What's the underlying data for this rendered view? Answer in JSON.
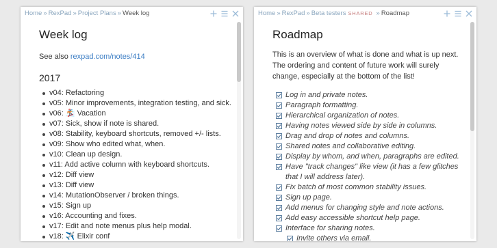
{
  "colors": {
    "breadcrumb": "#8aa6be",
    "accent_link": "#3b7dc4",
    "shared_badge": "#c47979",
    "checkbox": "#4a6f94"
  },
  "left_panel": {
    "breadcrumb": [
      "Home",
      "RexPad",
      "Project Plans",
      "Week log"
    ],
    "breadcrumb_separator": "»",
    "actions": [
      "plus-icon",
      "menu-icon",
      "close-icon"
    ],
    "title": "Week log",
    "see_also_prefix": "See also ",
    "see_also_link": "rexpad.com/notes/414",
    "year": "2017",
    "entries": [
      "v04: Refactoring",
      "v05: Minor improvements, integration testing, and sick.",
      "v06: 🏂 Vacation",
      "v07: Sick, show if note is shared.",
      "v08: Stability, keyboard shortcuts, removed +/- lists.",
      "v09: Show who edited what, when.",
      "v10: Clean up design.",
      "v11: Add active column with keyboard shortcuts.",
      "v12: Diff view",
      "v13: Diff view",
      "v14: MutationObserver / broken things.",
      "v15: Sign up",
      "v16: Accounting and fixes.",
      "v17: Edit and note menus plus help modal.",
      "v18: ✈️ Elixir conf"
    ]
  },
  "right_panel": {
    "breadcrumb": [
      "Home",
      "RexPad",
      "Beta testers"
    ],
    "shared_label": "Shared",
    "current": "Roadmap",
    "breadcrumb_separator": "»",
    "actions": [
      "plus-icon",
      "menu-icon",
      "close-icon"
    ],
    "title": "Roadmap",
    "intro": "This is an overview of what is done and what is up next. The ordering and content of future work will surely change, especially at the bottom of the list!",
    "tasks": [
      {
        "text": "Log in and private notes.",
        "done": true
      },
      {
        "text": "Paragraph formatting.",
        "done": true
      },
      {
        "text": "Hierarchical organization of notes.",
        "done": true
      },
      {
        "text": "Having notes viewed side by side in columns.",
        "done": true
      },
      {
        "text": "Drag and drop of notes and columns.",
        "done": true
      },
      {
        "text": "Shared notes and collaborative editing.",
        "done": true
      },
      {
        "text": "Display by whom, and when, paragraphs are edited.",
        "done": true
      },
      {
        "text": "Have \"track changes\" like view (it has a few glitches that I will address later).",
        "done": true
      },
      {
        "text": "Fix batch of most common stability issues.",
        "done": true
      },
      {
        "text": "Sign up page.",
        "done": true
      },
      {
        "text": "Add menus for changing style and note actions.",
        "done": true
      },
      {
        "text": "Add easy accessible shortcut help page.",
        "done": true
      },
      {
        "text": "Interface for sharing notes.",
        "done": true
      },
      {
        "text": "Invite others via email.",
        "done": true,
        "sub": true
      }
    ]
  }
}
